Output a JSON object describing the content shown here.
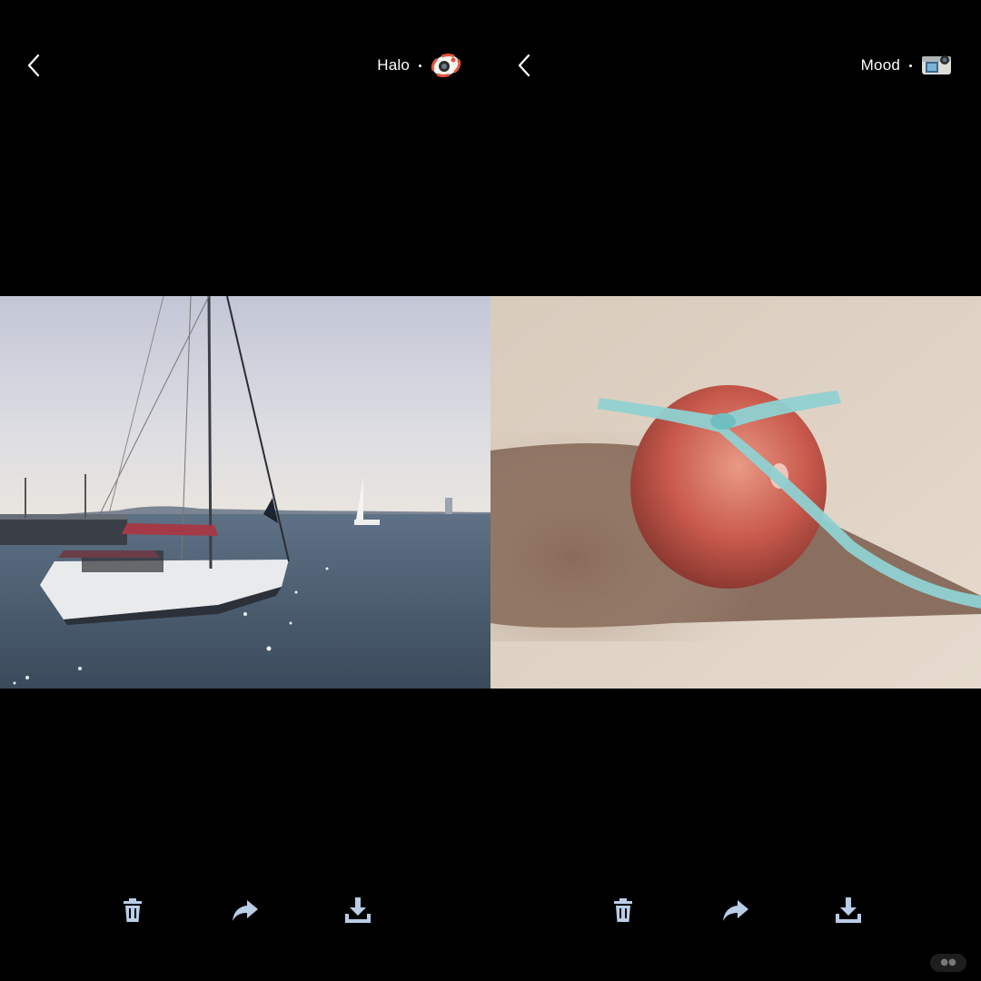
{
  "panels": [
    {
      "title": "Halo",
      "camera_icon": "halo-camera-icon",
      "back_icon": "chevron-left-icon",
      "photo_description_icon": "sailboat-photo",
      "tools": [
        "trash-icon",
        "share-icon",
        "download-icon"
      ]
    },
    {
      "title": "Mood",
      "camera_icon": "mood-camera-icon",
      "back_icon": "chevron-left-icon",
      "photo_description_icon": "apple-ribbon-photo",
      "tools": [
        "trash-icon",
        "share-icon",
        "download-icon"
      ]
    }
  ],
  "colors": {
    "background": "#000000",
    "icon": "#b9cde6",
    "text": "#ffffff"
  }
}
